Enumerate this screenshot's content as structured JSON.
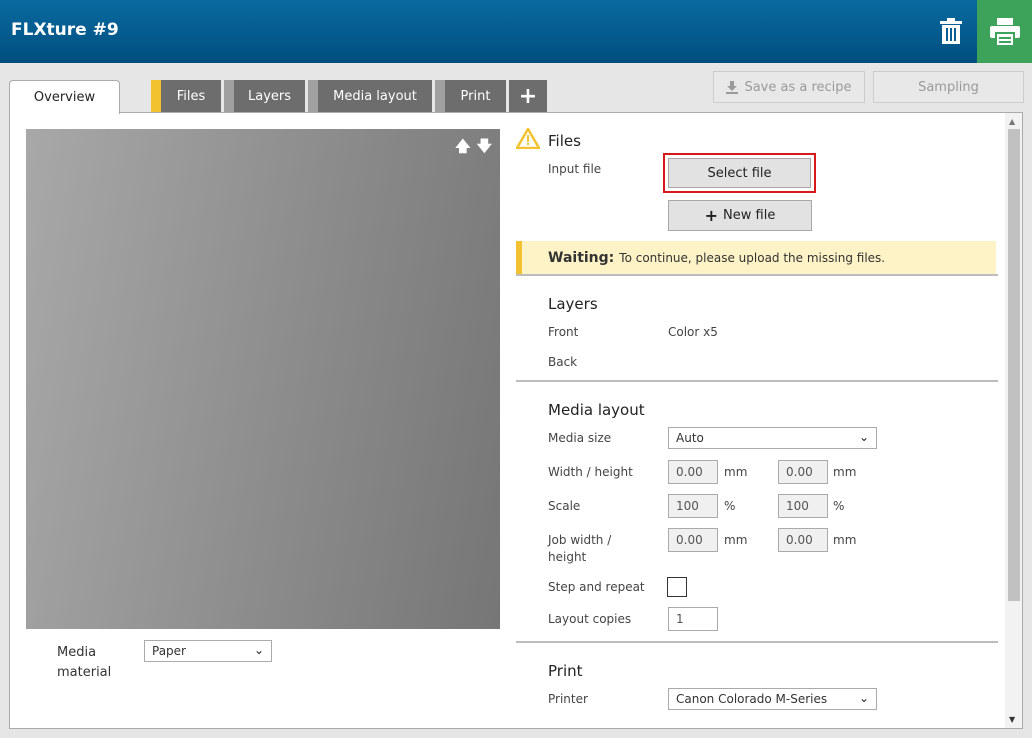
{
  "header": {
    "title": "FLXture #9"
  },
  "tabs": [
    {
      "label": "Overview"
    },
    {
      "label": "Files"
    },
    {
      "label": "Layers"
    },
    {
      "label": "Media layout"
    },
    {
      "label": "Print"
    }
  ],
  "actions": {
    "save_recipe": "Save as a recipe",
    "sampling": "Sampling"
  },
  "preview": {
    "media_material_label": "Media material",
    "media_material_value": "Paper"
  },
  "files": {
    "title": "Files",
    "input_file_label": "Input file",
    "select_file_label": "Select file",
    "new_file_label": "New file"
  },
  "waiting": {
    "title": "Waiting:",
    "message": "To continue, please upload the missing files."
  },
  "layers": {
    "title": "Layers",
    "front_label": "Front",
    "front_value": "Color x5",
    "back_label": "Back"
  },
  "media_layout": {
    "title": "Media layout",
    "media_size_label": "Media size",
    "media_size_value": "Auto",
    "width_height_label": "Width / height",
    "width_value": "0.00",
    "height_value": "0.00",
    "scale_label": "Scale",
    "scale_x": "100",
    "scale_y": "100",
    "job_width_height_label": "Job width / height",
    "job_width_value": "0.00",
    "job_height_value": "0.00",
    "unit_mm": "mm",
    "unit_pct": "%",
    "step_repeat_label": "Step and repeat",
    "layout_copies_label": "Layout copies",
    "layout_copies_value": "1"
  },
  "print": {
    "title": "Print",
    "printer_label": "Printer",
    "printer_value": "Canon Colorado M-Series"
  },
  "colors": {
    "header": "#005a8e",
    "print_button": "#3da35a",
    "tab": "#6d6d6d",
    "warning": "#f2c230",
    "highlight": "#d61a1a"
  }
}
